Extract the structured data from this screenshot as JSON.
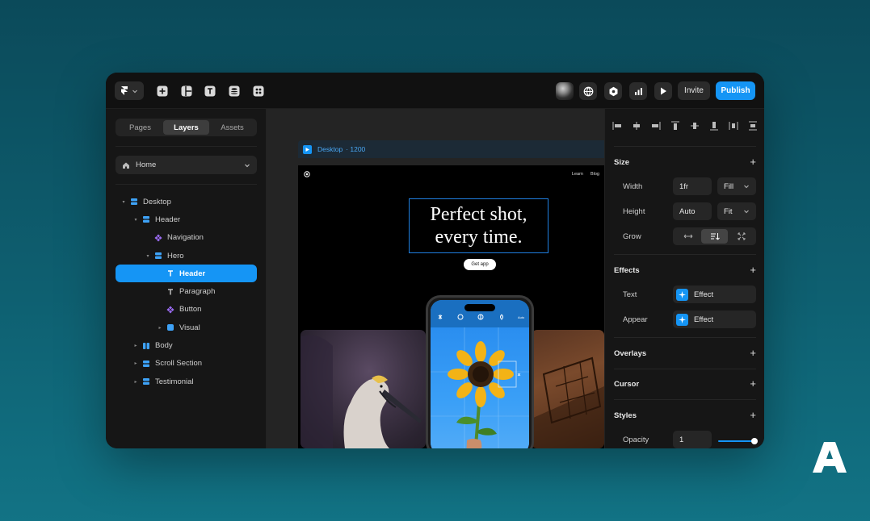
{
  "toolbar": {
    "invite_label": "Invite",
    "publish_label": "Publish",
    "icons": [
      "framer-logo-icon",
      "chevron-down-icon",
      "plus-icon",
      "layout-icon",
      "text-icon",
      "database-icon",
      "components-icon",
      "avatar",
      "globe-icon",
      "settings-icon",
      "analytics-icon",
      "play-icon"
    ]
  },
  "left_panel": {
    "tabs": [
      {
        "label": "Pages",
        "active": false
      },
      {
        "label": "Layers",
        "active": true
      },
      {
        "label": "Assets",
        "active": false
      }
    ],
    "page_select": "Home",
    "layers": [
      {
        "label": "Desktop",
        "depth": 0,
        "caret": "▾",
        "icon": "stack-icon"
      },
      {
        "label": "Header",
        "depth": 1,
        "caret": "▾",
        "icon": "stack-icon"
      },
      {
        "label": "Navigation",
        "depth": 2,
        "caret": "",
        "icon": "component-icon"
      },
      {
        "label": "Hero",
        "depth": 2,
        "caret": "▾",
        "icon": "stack-icon"
      },
      {
        "label": "Header",
        "depth": 3,
        "caret": "",
        "icon": "text-icon",
        "selected": true
      },
      {
        "label": "Paragraph",
        "depth": 3,
        "caret": "",
        "icon": "text-icon"
      },
      {
        "label": "Button",
        "depth": 3,
        "caret": "",
        "icon": "component-icon"
      },
      {
        "label": "Visual",
        "depth": 3,
        "caret": "▸",
        "icon": "frame-icon"
      },
      {
        "label": "Body",
        "depth": 1,
        "caret": "▸",
        "icon": "columns-icon"
      },
      {
        "label": "Scroll Section",
        "depth": 1,
        "caret": "▸",
        "icon": "stack-icon"
      },
      {
        "label": "Testimonial",
        "depth": 1,
        "caret": "▸",
        "icon": "stack-icon"
      }
    ]
  },
  "canvas": {
    "frame_label": "Desktop",
    "frame_width": "· 1200",
    "nav_links": [
      "Learn",
      "Blog"
    ],
    "hero_title_line1": "Perfect shot,",
    "hero_title_line2": "every time.",
    "cta_label": "Get app"
  },
  "right_panel": {
    "size": {
      "title": "Size",
      "width_label": "Width",
      "width_value": "1fr",
      "width_mode": "Fill",
      "height_label": "Height",
      "height_value": "Auto",
      "height_mode": "Fit",
      "grow_label": "Grow"
    },
    "effects": {
      "title": "Effects",
      "text_label": "Text",
      "text_value": "Effect",
      "appear_label": "Appear",
      "appear_value": "Effect"
    },
    "overlays_title": "Overlays",
    "cursor_title": "Cursor",
    "styles": {
      "title": "Styles",
      "opacity_label": "Opacity",
      "opacity_value": "1",
      "opacity_fraction": 1
    }
  },
  "colors": {
    "accent": "#1595f5",
    "window_bg": "#111111",
    "panel_bg": "#161616"
  }
}
